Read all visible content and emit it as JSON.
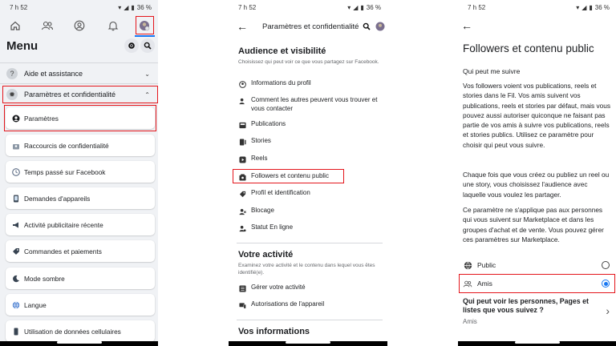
{
  "status": {
    "time": "7 h 52",
    "battery": "36 %"
  },
  "panel1": {
    "menu_title": "Menu",
    "sections": [
      {
        "label": "Aide et assistance",
        "icon": "help-icon",
        "chevron": "⌄"
      },
      {
        "label": "Paramètres et confidentialité",
        "icon": "settings-gear-icon",
        "chevron": "⌃"
      }
    ],
    "items": [
      {
        "label": "Paramètres",
        "icon": "user-circle-icon"
      },
      {
        "label": "Raccourcis de confidentialité",
        "icon": "lock-user-icon"
      },
      {
        "label": "Temps passé sur Facebook",
        "icon": "clock-icon"
      },
      {
        "label": "Demandes d'appareils",
        "icon": "device-icon"
      },
      {
        "label": "Activité publicitaire récente",
        "icon": "megaphone-icon"
      },
      {
        "label": "Commandes et paiements",
        "icon": "tag-icon"
      },
      {
        "label": "Mode sombre",
        "icon": "moon-icon"
      },
      {
        "label": "Langue",
        "icon": "globe-icon"
      },
      {
        "label": "Utilisation de données cellulaires",
        "icon": "phone-icon"
      }
    ]
  },
  "panel2": {
    "title": "Paramètres et confidentialité",
    "audience": {
      "heading": "Audience et visibilité",
      "description": "Choisissez qui peut voir ce que vous partagez sur Facebook.",
      "items": [
        "Informations du profil",
        "Comment les autres peuvent vous trouver et vous contacter",
        "Publications",
        "Stories",
        "Reels",
        "Followers et contenu public",
        "Profil et identification",
        "Blocage",
        "Statut En ligne"
      ]
    },
    "activity": {
      "heading": "Votre activité",
      "description": "Examinez votre activité et le contenu dans lequel vous êtes identifié(e).",
      "items": [
        "Gérer votre activité",
        "Autorisations de l'appareil"
      ]
    },
    "info_heading": "Vos informations"
  },
  "panel3": {
    "title": "Followers et contenu public",
    "subtitle": "Qui peut me suivre",
    "para1": "Vos followers voient vos publications, reels et stories dans le Fil. Vos amis suivent vos publications, reels et stories par défaut, mais vous pouvez aussi autoriser quiconque ne faisant pas partie de vos amis à suivre vos publications, reels et stories publics. Utilisez ce paramètre pour choisir qui peut vous suivre.",
    "para2": "Chaque fois que vous créez ou publiez un reel ou une story, vous choisissez l'audience avec laquelle vous voulez les partager.",
    "para3": "Ce paramètre ne s'applique pas aux personnes qui vous suivent sur Marketplace et dans les groupes d'achat et de vente. Vous pouvez gérer ces paramètres sur Marketplace.",
    "options": [
      {
        "label": "Public",
        "selected": false
      },
      {
        "label": "Amis",
        "selected": true
      }
    ],
    "question": "Qui peut voir les personnes, Pages et listes que vous suivez ?",
    "question_value": "Amis"
  },
  "colors": {
    "accent": "#1877f2",
    "highlight": "#e4151b",
    "menu_bg": "#f0f2f5"
  }
}
